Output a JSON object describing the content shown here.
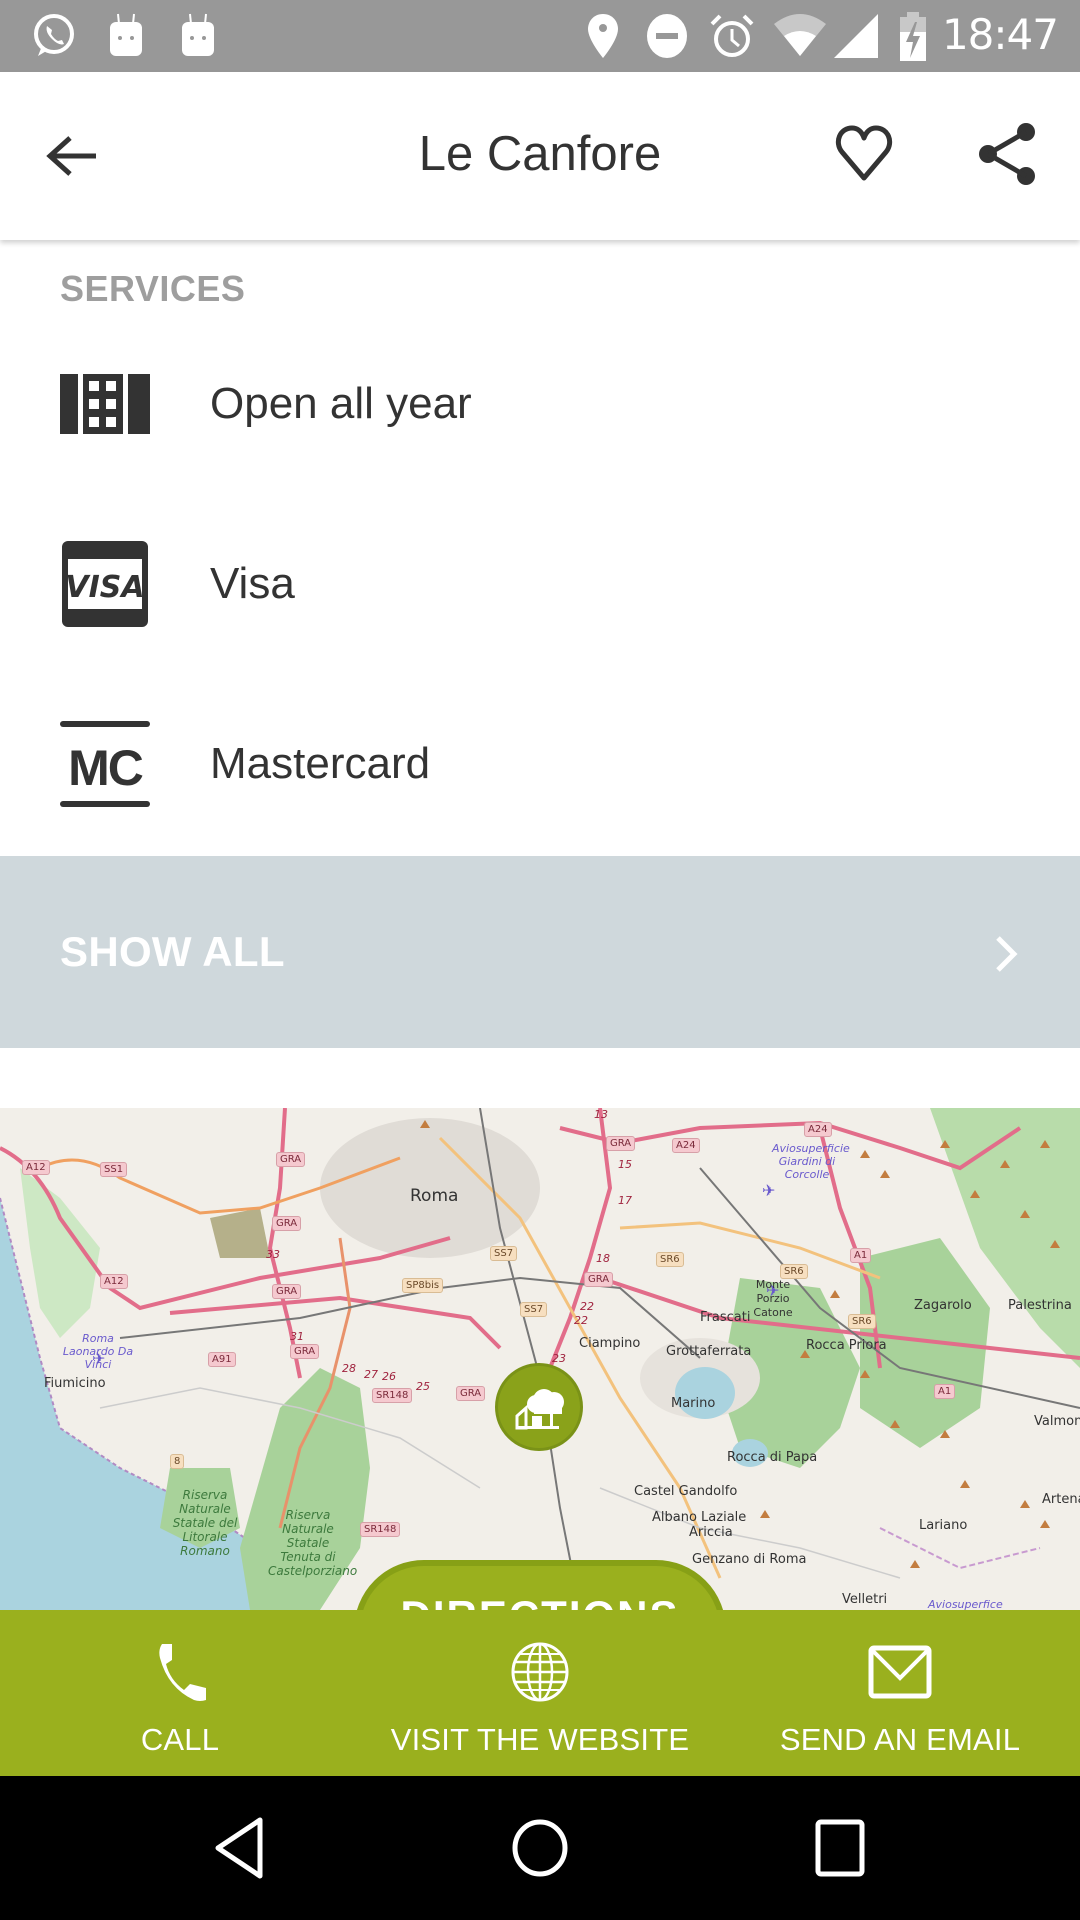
{
  "status_bar": {
    "time": "18:47",
    "left_icons": [
      "whatsapp-icon",
      "android-icon",
      "android-icon"
    ],
    "right_icons": [
      "location-icon",
      "do-not-disturb-icon",
      "alarm-icon",
      "wifi-icon",
      "signal-icon",
      "battery-charging-icon"
    ]
  },
  "app_bar": {
    "title": "Le Canfore",
    "back_icon": "arrow-back-icon",
    "favorite_icon": "heart-outline-icon",
    "share_icon": "share-icon"
  },
  "services": {
    "section_label": "SERVICES",
    "items": [
      {
        "icon": "calendar-building-icon",
        "label": "Open all year"
      },
      {
        "icon": "visa-card-icon",
        "label": "Visa"
      },
      {
        "icon": "mastercard-icon",
        "label": "Mastercard"
      }
    ],
    "show_all_label": "SHOW ALL"
  },
  "map": {
    "marker_icon": "house-tree-icon",
    "directions_label": "DIRECTIONS",
    "places": [
      "Roma",
      "Fiumicino",
      "Ciampino",
      "Frascati",
      "Monte Porzio Catone",
      "Grottaferrata",
      "Rocca Priora",
      "Marino",
      "Rocca di Papa",
      "Castel Gandolfo",
      "Albano Laziale",
      "Ariccia",
      "Genzano di Roma",
      "Velletri",
      "Lariano",
      "Zagarolo",
      "Palestrina",
      "Valmontone",
      "Artena"
    ],
    "reserves": [
      "Riserva Naturale Statale del Litorale Romano",
      "Riserva Naturale Statale Tenuta di Castelporziano"
    ],
    "airports": [
      "Roma Laonardo Da Vinci",
      "Aviosuperficie Giardini di Corcolle",
      "Aviosuperfice"
    ],
    "road_shields": [
      "A12",
      "SS1",
      "GRA",
      "A24",
      "A91",
      "SS7",
      "SP8bis",
      "SR148",
      "SR6",
      "A1",
      "8"
    ],
    "km_markers": [
      "13",
      "15",
      "17",
      "18",
      "22",
      "23",
      "25",
      "26",
      "27",
      "28",
      "31",
      "33"
    ]
  },
  "action_bar": {
    "items": [
      {
        "icon": "phone-icon",
        "label": "CALL"
      },
      {
        "icon": "globe-icon",
        "label": "VISIT THE WEBSITE"
      },
      {
        "icon": "mail-icon",
        "label": "SEND AN EMAIL"
      }
    ]
  },
  "nav_bar": {
    "back": "nav-back-icon",
    "home": "nav-home-icon",
    "recents": "nav-recents-icon"
  },
  "colors": {
    "accent_green": "#9ab01e",
    "marker_green": "#8aa21a",
    "show_all_bg": "#cfd8dc",
    "section_label": "#9e9e9e",
    "text_dark": "#333333",
    "status_bar": "#989898"
  }
}
